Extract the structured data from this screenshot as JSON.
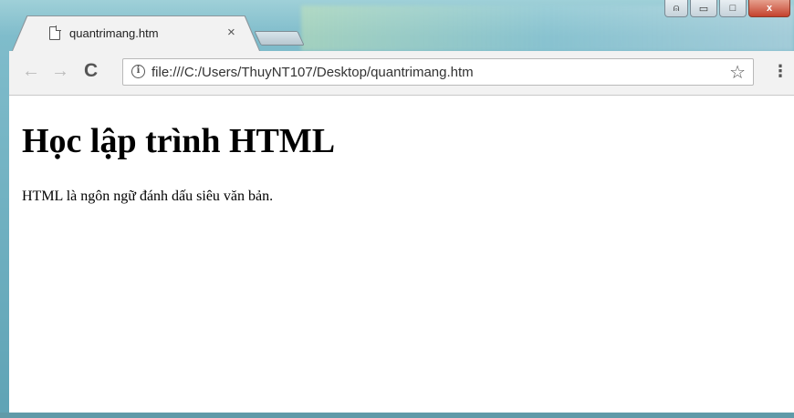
{
  "browser": {
    "tab": {
      "title": "quantrimang.htm",
      "icon": "page-icon",
      "close_glyph": "×"
    },
    "toolbar": {
      "back_glyph": "←",
      "forward_glyph": "→",
      "reload_glyph": "C",
      "url": "file:///C:/Users/ThuyNT107/Desktop/quantrimang.htm",
      "info_glyph": "i",
      "bookmark_glyph": "☆",
      "menu_glyph": "⋮"
    },
    "window_controls": {
      "user_glyph": "⍝",
      "minimize_glyph": "▭",
      "maximize_glyph": "□",
      "close_glyph": "x"
    }
  },
  "page": {
    "heading": "Học lập trình HTML",
    "paragraph": "HTML là ngôn ngữ đánh dấu siêu văn bản."
  },
  "colors": {
    "tab_bg": "#f2f2f2",
    "page_bg": "#ffffff",
    "desktop": "#6fa8b8"
  }
}
